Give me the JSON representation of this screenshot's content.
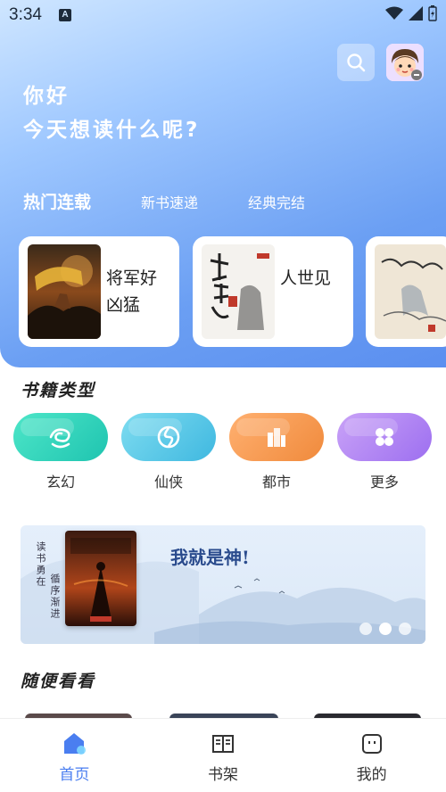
{
  "status_bar": {
    "time": "3:34",
    "a_badge": "A"
  },
  "header": {
    "greeting_line1": "你好",
    "greeting_line2": "今天想读什么呢?",
    "search_icon": "search-icon",
    "avatar_icon": "avatar"
  },
  "tabs": [
    {
      "label": "热门连载",
      "active": true
    },
    {
      "label": "新书速递",
      "active": false
    },
    {
      "label": "经典完结",
      "active": false
    }
  ],
  "featured_books": [
    {
      "title": "将军好凶猛"
    },
    {
      "title": "人世见"
    },
    {
      "title": ""
    }
  ],
  "genres_section": {
    "title": "书籍类型",
    "items": [
      {
        "label": "玄幻",
        "color": "#2fd1b8",
        "icon": "dragon-icon"
      },
      {
        "label": "仙侠",
        "color": "#4fc8e8",
        "icon": "swirl-icon"
      },
      {
        "label": "都市",
        "color": "#f59a52",
        "icon": "building-icon"
      },
      {
        "label": "更多",
        "color": "#b182f0",
        "icon": "grid-icon"
      }
    ]
  },
  "banner": {
    "title": "我就是神!",
    "vertical_text_1": "读书勇在",
    "vertical_text_2": "循序渐进",
    "active_dot": 1,
    "dot_count": 3
  },
  "browse_section": {
    "title": "随便看看"
  },
  "tabbar": [
    {
      "label": "首页",
      "icon": "home-icon",
      "active": true
    },
    {
      "label": "书架",
      "icon": "book-icon",
      "active": false
    },
    {
      "label": "我的",
      "icon": "profile-icon",
      "active": false
    }
  ],
  "colors": {
    "accent": "#4a7ef0",
    "header_gradient_end": "#5b8ff0"
  }
}
